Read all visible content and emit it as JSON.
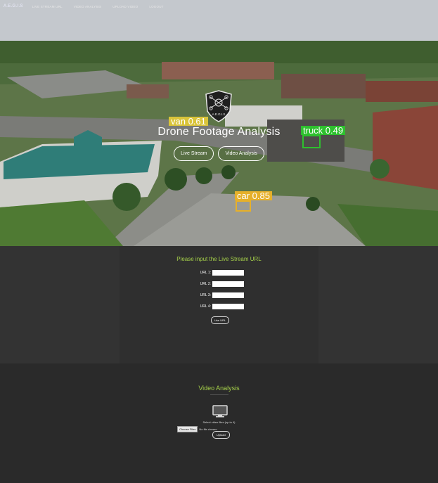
{
  "nav": {
    "brand": "A.E.G.I.S",
    "links": [
      "LIVE STREAM URL",
      "VIDEO ANALYSIS",
      "UPLOAD VIDEO",
      "LOGOUT"
    ]
  },
  "hero": {
    "title": "Drone Footage Analysis",
    "buttons": [
      "Live Stream",
      "Video Analysis"
    ],
    "logo_text": "A.E.G.I.S",
    "detections": [
      {
        "label": "van 0.61",
        "color": "#d9c43a"
      },
      {
        "label": "truck 0.49",
        "color": "#2ec02e"
      },
      {
        "label": "car 0.85",
        "color": "#e6b02a"
      }
    ]
  },
  "live_stream": {
    "title": "Please input the Live Stream URL",
    "fields": [
      "URL 1:",
      "URL 2:",
      "URL 3:",
      "URL 4:"
    ],
    "button": "Use URL"
  },
  "video_analysis": {
    "title": "Video Analysis",
    "icon": "monitor-icon",
    "select_text": "Select video files (up to 4)",
    "choose_label": "Choose Files",
    "no_file_text": "No file chosen",
    "upload_label": "Upload"
  },
  "colors": {
    "accent": "#a6d14a",
    "dark_bg": "#2b2b2b"
  }
}
